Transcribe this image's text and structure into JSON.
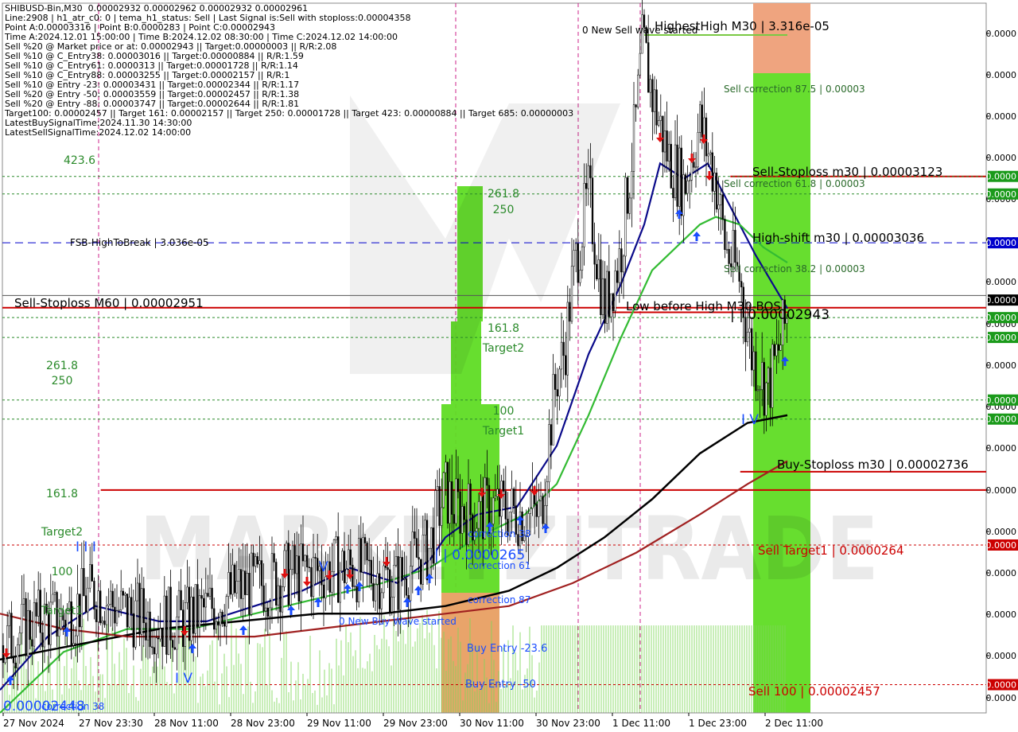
{
  "info_lines": [
    "SHIBUSD-Bin,M30  0.00002932 0.00002962 0.00002932 0.00002961",
    "Line:2908 | h1_atr_c0: 0 | tema_h1_status: Sell | Last Signal is:Sell with stoploss:0.00004358",
    "Point A:0.00003316 | Point B:0.0000283 | Point C:0.00002943",
    "Time A:2024.12.01 15:00:00 | Time B:2024.12.02 08:30:00 | Time C:2024.12.02 14:00:00",
    "Sell %20 @ Market price or at: 0.00002943 || Target:0.00000003 || R/R:2.08",
    "Sell %10 @ C_Entry38: 0.00003016 || Target:0.00000884 || R/R:1.59",
    "Sell %10 @ C_Entry61: 0.0000313 || Target:0.00001728 || R/R:1.14",
    "Sell %10 @ C_Entry88: 0.00003255 || Target:0.00002157 || R/R:1",
    "Sell %10 @ Entry -23: 0.00003431 || Target:0.00002344 || R/R:1.17",
    "Sell %20 @ Entry -50: 0.00003559 || Target:0.00002457 || R/R:1.38",
    "Sell %20 @ Entry -88: 0.00003747 || Target:0.00002644 || R/R:1.81",
    "Target100: 0.00002457 || Target 161: 0.00002157 || Target 250: 0.00001728 || Target 423: 0.00000884 || Target 685: 0.00000003",
    "LatestBuySignalTime:2024.11.30 14:30:00",
    "LatestSellSignalTime:2024.12.02 14:00:00"
  ],
  "chart_data": {
    "type": "candlestick",
    "symbol": "SHIBUSD-Bin",
    "timeframe": "M30",
    "watermark": "MARKETZITRADE",
    "price_axis_labels": [
      "0.0000",
      "0.0000",
      "0.0000",
      "0.0000",
      "0.0000",
      "0.0000",
      "0.0000",
      "0.0000",
      "0.0000",
      "0.0000",
      "0.0000",
      "0.0000",
      "0.0000",
      "0.0000",
      "0.0000",
      "0.0000",
      "0.0000"
    ],
    "price_range": [
      2.42e-05,
      3.35e-05
    ],
    "x_tick_labels": [
      "27 Nov 2024",
      "27 Nov 23:30",
      "28 Nov 11:00",
      "28 Nov 23:00",
      "29 Nov 11:00",
      "29 Nov 23:00",
      "30 Nov 11:00",
      "30 Nov 23:00",
      "1 Dec 11:00",
      "1 Dec 23:00",
      "2 Dec 11:00"
    ],
    "price_tags": [
      {
        "text": "0.0000",
        "value": 3.123e-05,
        "color": "#1a9a1a"
      },
      {
        "text": "0.0000",
        "value": 3.1e-05,
        "color": "#1a9a1a"
      },
      {
        "text": "0.0000",
        "value": 3.036e-05,
        "color": "#0000cc"
      },
      {
        "text": "0.0000",
        "value": 2.961e-05,
        "color": "#000000"
      },
      {
        "text": "0.0000",
        "value": 2.938e-05,
        "color": "#1a9a1a"
      },
      {
        "text": "0.0000",
        "value": 2.912e-05,
        "color": "#1a9a1a"
      },
      {
        "text": "0.0000",
        "value": 2.83e-05,
        "color": "#1a9a1a"
      },
      {
        "text": "0.0000",
        "value": 2.805e-05,
        "color": "#1a9a1a"
      },
      {
        "text": "0.0000",
        "value": 2.64e-05,
        "color": "#cc0000"
      },
      {
        "text": "0.0000",
        "value": 2.457e-05,
        "color": "#cc0000"
      }
    ],
    "levels": [
      {
        "label": "Sell-Stoploss m30 | 0.00003123",
        "value": 3.123e-05,
        "color": "#cc0000",
        "style": "solid",
        "x_from_frac": 0.74
      },
      {
        "label": "FSB-HighToBreak | 3.036e-05",
        "value": 3.036e-05,
        "color": "#0000cc",
        "style": "dashed",
        "x_from_frac": 0.0
      },
      {
        "label": "High-shift m30 | 0.00003036",
        "value": 3.036e-05,
        "color": "#0000cc",
        "style": "none",
        "x_from_frac": 0.74
      },
      {
        "label": "Sell-Stoploss M60 | 0.00002951",
        "value": 2.951e-05,
        "color": "#cc0000",
        "style": "solid",
        "x_from_frac": 0.0
      },
      {
        "label": "Buy-Stoploss m30 | 0.00002736",
        "value": 2.736e-05,
        "color": "#cc0000",
        "style": "solid",
        "x_from_frac": 0.75
      },
      {
        "label": "",
        "value": 2.712e-05,
        "color": "#cc0000",
        "style": "solid",
        "x_from_frac": 0.1
      },
      {
        "label": "Sell Target1 | 0.0000264",
        "value": 2.64e-05,
        "color": "#cc0000",
        "style": "dotted",
        "x_from_frac": 0.0
      },
      {
        "label": "Sell 100 | 0.00002457",
        "value": 2.457e-05,
        "color": "#cc0000",
        "style": "dotted",
        "x_from_frac": 0.0
      }
    ],
    "annotations": [
      "HighestHigh   M30 | 3.316e-05",
      "0 New Sell wave started",
      "Sell correction 87.5 | 0.00003",
      "Sell correction 61.8 | 0.00003",
      "Sell correction 38.2 | 0.00003",
      "Low before High   M30-BOS",
      "| | 0.00002943",
      "I V",
      "I V",
      "I I I",
      "V",
      "| | 0.0000265",
      "correction 38",
      "correction 61",
      "correction 87",
      "0 New Buy Wave started",
      "Buy Entry -23.6",
      "Buy Entry -50",
      "0.00002448",
      "correction 38",
      "423.6",
      "261.8",
      "250",
      "161.8",
      "Target2",
      "100",
      "Target1",
      "261.8",
      "250",
      "161.8",
      "Target2",
      "100",
      "Target1"
    ],
    "series": [
      {
        "name": "",
        "anchors": [
          [
            0,
            2.505e-05
          ],
          [
            40,
            2.538e-05
          ],
          [
            80,
            2.545e-05
          ],
          [
            120,
            2.58e-05
          ],
          [
            150,
            2.555e-05
          ],
          [
            200,
            2.54e-05
          ],
          [
            230,
            2.54e-05
          ],
          [
            260,
            2.555e-05
          ],
          [
            300,
            2.582e-05
          ],
          [
            340,
            2.592e-05
          ],
          [
            360,
            2.6e-05
          ],
          [
            400,
            2.606e-05
          ],
          [
            440,
            2.61e-05
          ],
          [
            480,
            2.6e-05
          ],
          [
            500,
            2.59e-05
          ],
          [
            520,
            2.62e-05
          ],
          [
            540,
            2.635e-05
          ],
          [
            550,
            2.68e-05
          ],
          [
            560,
            2.71e-05
          ],
          [
            570,
            2.69e-05
          ],
          [
            600,
            2.68e-05
          ],
          [
            620,
            2.69e-05
          ],
          [
            640,
            2.685e-05
          ],
          [
            660,
            2.68e-05
          ],
          [
            680,
            2.68e-05
          ],
          [
            690,
            2.78e-05
          ],
          [
            700,
            2.86e-05
          ],
          [
            710,
            2.895e-05
          ],
          [
            720,
            2.99e-05
          ],
          [
            740,
            3.1e-05
          ],
          [
            760,
            2.95e-05
          ],
          [
            780,
            3.02e-05
          ],
          [
            800,
            3.2e-05
          ],
          [
            808,
            3.3e-05
          ],
          [
            820,
            3.23e-05
          ],
          [
            840,
            3.15e-05
          ],
          [
            860,
            3.11e-05
          ],
          [
            880,
            3.19e-05
          ],
          [
            900,
            3.12e-05
          ],
          [
            912,
            3.03e-05
          ],
          [
            930,
            2.99e-05
          ],
          [
            945,
            2.89e-05
          ],
          [
            955,
            2.87e-05
          ],
          [
            965,
            2.84e-05
          ],
          [
            975,
            2.88e-05
          ],
          [
            990,
            2.94e-05
          ]
        ]
      }
    ],
    "ma_series": [
      {
        "color": "#0a0a8a",
        "anchors": [
          [
            0,
            2.45e-05
          ],
          [
            60,
            2.52e-05
          ],
          [
            120,
            2.56e-05
          ],
          [
            200,
            2.54e-05
          ],
          [
            260,
            2.54e-05
          ],
          [
            320,
            2.56e-05
          ],
          [
            380,
            2.58e-05
          ],
          [
            440,
            2.61e-05
          ],
          [
            500,
            2.59e-05
          ],
          [
            540,
            2.62e-05
          ],
          [
            560,
            2.65e-05
          ],
          [
            600,
            2.68e-05
          ],
          [
            650,
            2.69e-05
          ],
          [
            700,
            2.77e-05
          ],
          [
            740,
            2.89e-05
          ],
          [
            780,
            2.98e-05
          ],
          [
            810,
            3.06e-05
          ],
          [
            830,
            3.14e-05
          ],
          [
            860,
            3.12e-05
          ],
          [
            890,
            3.14e-05
          ],
          [
            920,
            3.08e-05
          ],
          [
            950,
            3.02e-05
          ],
          [
            990,
            2.95e-05
          ]
        ]
      },
      {
        "color": "#33bb33",
        "anchors": [
          [
            0,
            2.42e-05
          ],
          [
            80,
            2.5e-05
          ],
          [
            160,
            2.53e-05
          ],
          [
            240,
            2.53e-05
          ],
          [
            320,
            2.55e-05
          ],
          [
            400,
            2.57e-05
          ],
          [
            480,
            2.59e-05
          ],
          [
            540,
            2.61e-05
          ],
          [
            600,
            2.65e-05
          ],
          [
            660,
            2.68e-05
          ],
          [
            700,
            2.72e-05
          ],
          [
            740,
            2.81e-05
          ],
          [
            780,
            2.91e-05
          ],
          [
            820,
            3e-05
          ],
          [
            850,
            3.03e-05
          ],
          [
            880,
            3.06e-05
          ],
          [
            900,
            3.07e-05
          ],
          [
            930,
            3.06e-05
          ],
          [
            960,
            3.03e-05
          ],
          [
            990,
            3.01e-05
          ]
        ]
      },
      {
        "color": "#000000",
        "anchors": [
          [
            0,
            2.49e-05
          ],
          [
            100,
            2.51e-05
          ],
          [
            200,
            2.53e-05
          ],
          [
            300,
            2.54e-05
          ],
          [
            400,
            2.55e-05
          ],
          [
            480,
            2.55e-05
          ],
          [
            560,
            2.56e-05
          ],
          [
            640,
            2.58e-05
          ],
          [
            700,
            2.61e-05
          ],
          [
            760,
            2.65e-05
          ],
          [
            820,
            2.7e-05
          ],
          [
            880,
            2.76e-05
          ],
          [
            940,
            2.8e-05
          ],
          [
            990,
            2.81e-05
          ]
        ]
      },
      {
        "color": "#a02020",
        "anchors": [
          [
            0,
            2.55e-05
          ],
          [
            80,
            2.53e-05
          ],
          [
            160,
            2.52e-05
          ],
          [
            240,
            2.52e-05
          ],
          [
            320,
            2.52e-05
          ],
          [
            400,
            2.53e-05
          ],
          [
            480,
            2.54e-05
          ],
          [
            560,
            2.55e-05
          ],
          [
            640,
            2.56e-05
          ],
          [
            720,
            2.59e-05
          ],
          [
            800,
            2.63e-05
          ],
          [
            880,
            2.68e-05
          ],
          [
            940,
            2.72e-05
          ],
          [
            990,
            2.75e-05
          ]
        ]
      }
    ]
  }
}
